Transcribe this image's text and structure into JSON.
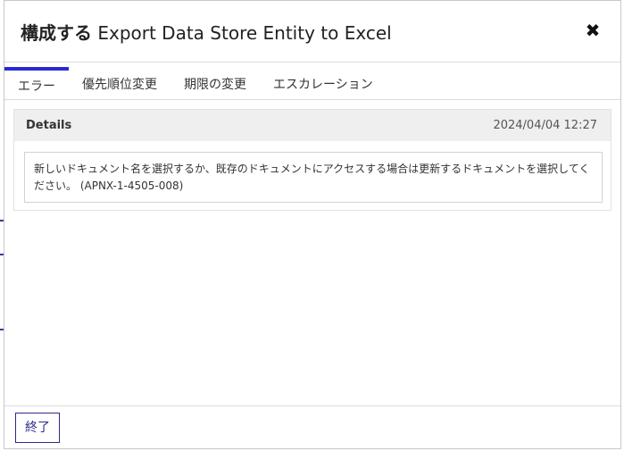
{
  "dialog": {
    "title_prefix": "構成する",
    "title_main": "Export Data Store Entity to Excel",
    "close_glyph": "✖"
  },
  "tabs": [
    {
      "label": "エラー",
      "active": true
    },
    {
      "label": "優先順位変更",
      "active": false
    },
    {
      "label": "期限の変更",
      "active": false
    },
    {
      "label": "エスカレーション",
      "active": false
    }
  ],
  "details": {
    "title": "Details",
    "timestamp": "2024/04/04 12:27",
    "message": "新しいドキュメント名を選択するか、既存のドキュメントにアクセスする場合は更新するドキュメントを選択してください。 (APNX-1-4505-008)"
  },
  "footer": {
    "end_label": "終了"
  },
  "colors": {
    "accent": "#2a2ad4",
    "button_border": "#2a2a8a"
  },
  "icons": {
    "close": "close-icon"
  }
}
